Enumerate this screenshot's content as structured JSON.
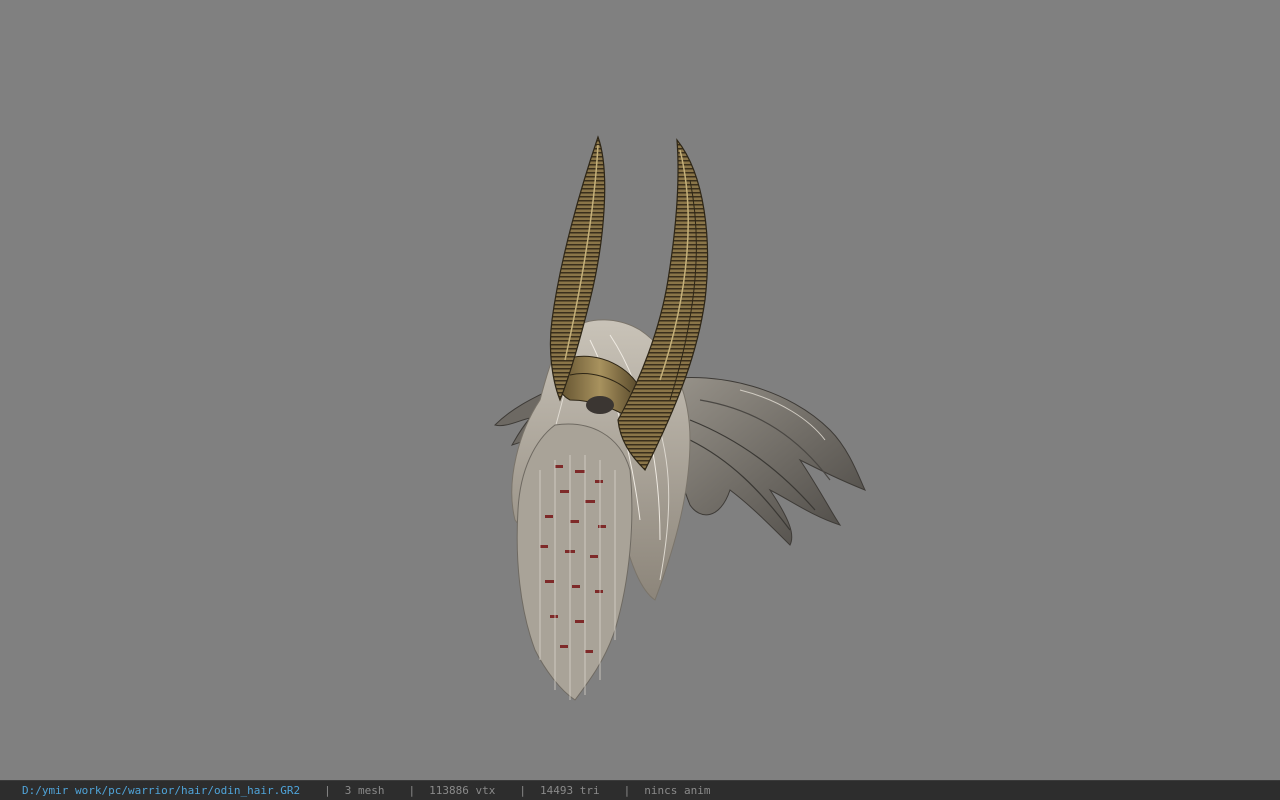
{
  "viewer": {
    "background_color": "#808080",
    "model_name": "odin_hair"
  },
  "status_bar": {
    "file_path": "D:/ymir work/pc/warrior/hair/odin_hair.GR2",
    "separator": "|",
    "mesh_count": "3 mesh",
    "vertex_count": "113886 vtx",
    "triangle_count": "14493 tri",
    "animation": "nincs anim",
    "path_color": "#4fa3d8",
    "bar_color": "#2d2d2d"
  }
}
